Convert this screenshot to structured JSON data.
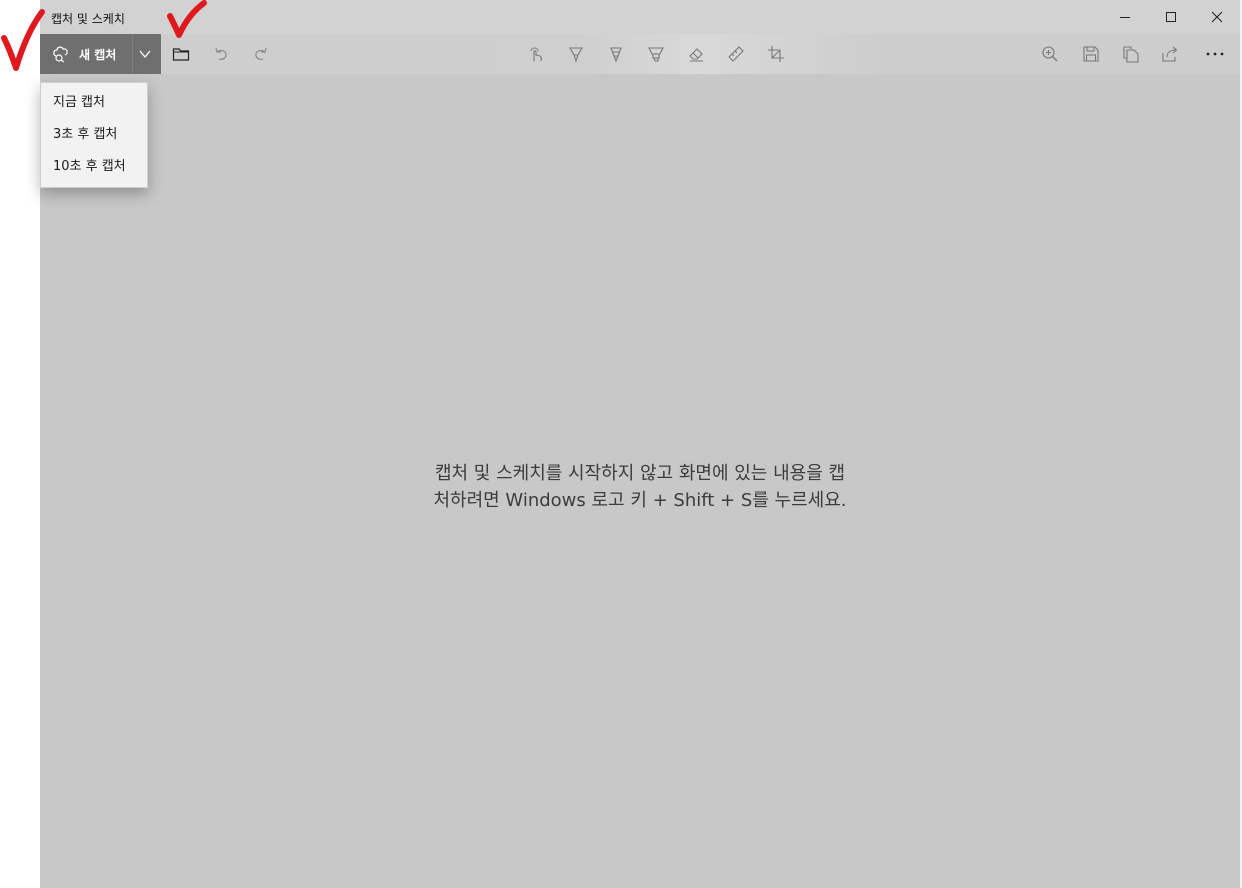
{
  "window": {
    "title": "캡처 및 스케치",
    "controls": {
      "minimize_icon": "minimize-icon",
      "maximize_icon": "maximize-icon",
      "close_icon": "close-icon"
    }
  },
  "toolbar": {
    "new_capture_label": "새 캡처",
    "left_icons": [
      "open-folder-icon",
      "undo-icon",
      "redo-icon"
    ],
    "center_icons": [
      "touch-writing-icon",
      "ballpoint-pen-icon",
      "pencil-icon",
      "highlighter-icon",
      "eraser-icon",
      "ruler-icon",
      "crop-icon"
    ],
    "right_icons": [
      "zoom-icon",
      "save-icon",
      "copy-icon",
      "share-icon",
      "more-icon"
    ]
  },
  "dropdown_menu": {
    "items": [
      {
        "label": "지금 캡처"
      },
      {
        "label": "3초 후 캡처"
      },
      {
        "label": "10초 후 캡처"
      }
    ]
  },
  "canvas": {
    "message_line1": "캡처 및 스케치를 시작하지 않고 화면에 있는 내용을 캡",
    "message_line2": "처하려면 Windows 로고 키 + Shift + S를 누르세요."
  },
  "annotations": {
    "check_mark_color": "#e0191f"
  },
  "colors": {
    "canvas_bg": "#c8c8c8",
    "new_capture_bg": "#6f6f6f",
    "menu_bg": "#f2f2f2"
  }
}
